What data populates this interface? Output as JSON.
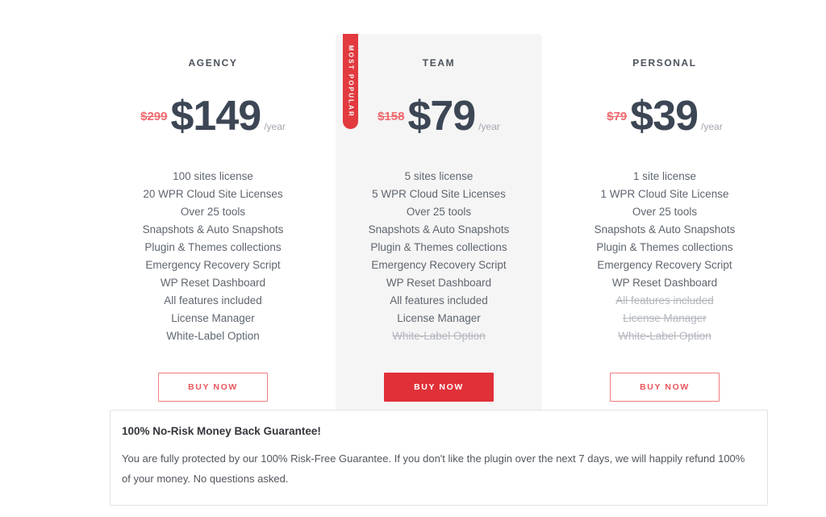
{
  "theme": {
    "page_background": "#ffffff",
    "featured_card_background": "#f5f5f5",
    "accent_red": "#e03038",
    "ribbon_red": "#e23a3f",
    "old_price_red": "#ef6a6e",
    "price_dark": "#3c4654",
    "muted_text": "#b3b7bd"
  },
  "plans": [
    {
      "name": "AGENCY",
      "featured": false,
      "ribbon": null,
      "price_old": "$299",
      "price_new": "$149",
      "price_period": "/year",
      "features": [
        {
          "label": "100 sites license",
          "included": true
        },
        {
          "label": "20 WPR Cloud Site Licenses",
          "included": true
        },
        {
          "label": "Over 25 tools",
          "included": true
        },
        {
          "label": "Snapshots & Auto Snapshots",
          "included": true
        },
        {
          "label": "Plugin & Themes collections",
          "included": true
        },
        {
          "label": "Emergency Recovery Script",
          "included": true
        },
        {
          "label": "WP Reset Dashboard",
          "included": true
        },
        {
          "label": "All features included",
          "included": true
        },
        {
          "label": "License Manager",
          "included": true
        },
        {
          "label": "White-Label Option",
          "included": true
        }
      ],
      "cta_label": "Buy Now",
      "cta_style": "outline"
    },
    {
      "name": "TEAM",
      "featured": true,
      "ribbon": "MOST POPULAR",
      "price_old": "$158",
      "price_new": "$79",
      "price_period": "/year",
      "features": [
        {
          "label": "5 sites license",
          "included": true
        },
        {
          "label": "5 WPR Cloud Site Licenses",
          "included": true
        },
        {
          "label": "Over 25 tools",
          "included": true
        },
        {
          "label": "Snapshots & Auto Snapshots",
          "included": true
        },
        {
          "label": "Plugin & Themes collections",
          "included": true
        },
        {
          "label": "Emergency Recovery Script",
          "included": true
        },
        {
          "label": "WP Reset Dashboard",
          "included": true
        },
        {
          "label": "All features included",
          "included": true
        },
        {
          "label": "License Manager",
          "included": true
        },
        {
          "label": "White-Label Option",
          "included": false
        }
      ],
      "cta_label": "Buy Now",
      "cta_style": "primary"
    },
    {
      "name": "PERSONAL",
      "featured": false,
      "ribbon": null,
      "price_old": "$79",
      "price_new": "$39",
      "price_period": "/year",
      "features": [
        {
          "label": "1 site license",
          "included": true
        },
        {
          "label": "1 WPR Cloud Site License",
          "included": true
        },
        {
          "label": "Over 25 tools",
          "included": true
        },
        {
          "label": "Snapshots & Auto Snapshots",
          "included": true
        },
        {
          "label": "Plugin & Themes collections",
          "included": true
        },
        {
          "label": "Emergency Recovery Script",
          "included": true
        },
        {
          "label": "WP Reset Dashboard",
          "included": true
        },
        {
          "label": "All features included",
          "included": false
        },
        {
          "label": "License Manager",
          "included": false
        },
        {
          "label": "White-Label Option",
          "included": false
        }
      ],
      "cta_label": "Buy Now",
      "cta_style": "outline"
    }
  ],
  "guarantee": {
    "title": "100% No-Risk Money Back Guarantee!",
    "body": "You are fully protected by our 100% Risk-Free Guarantee. If you don't like the plugin over the next 7 days, we will happily refund 100% of your money. No questions asked."
  }
}
